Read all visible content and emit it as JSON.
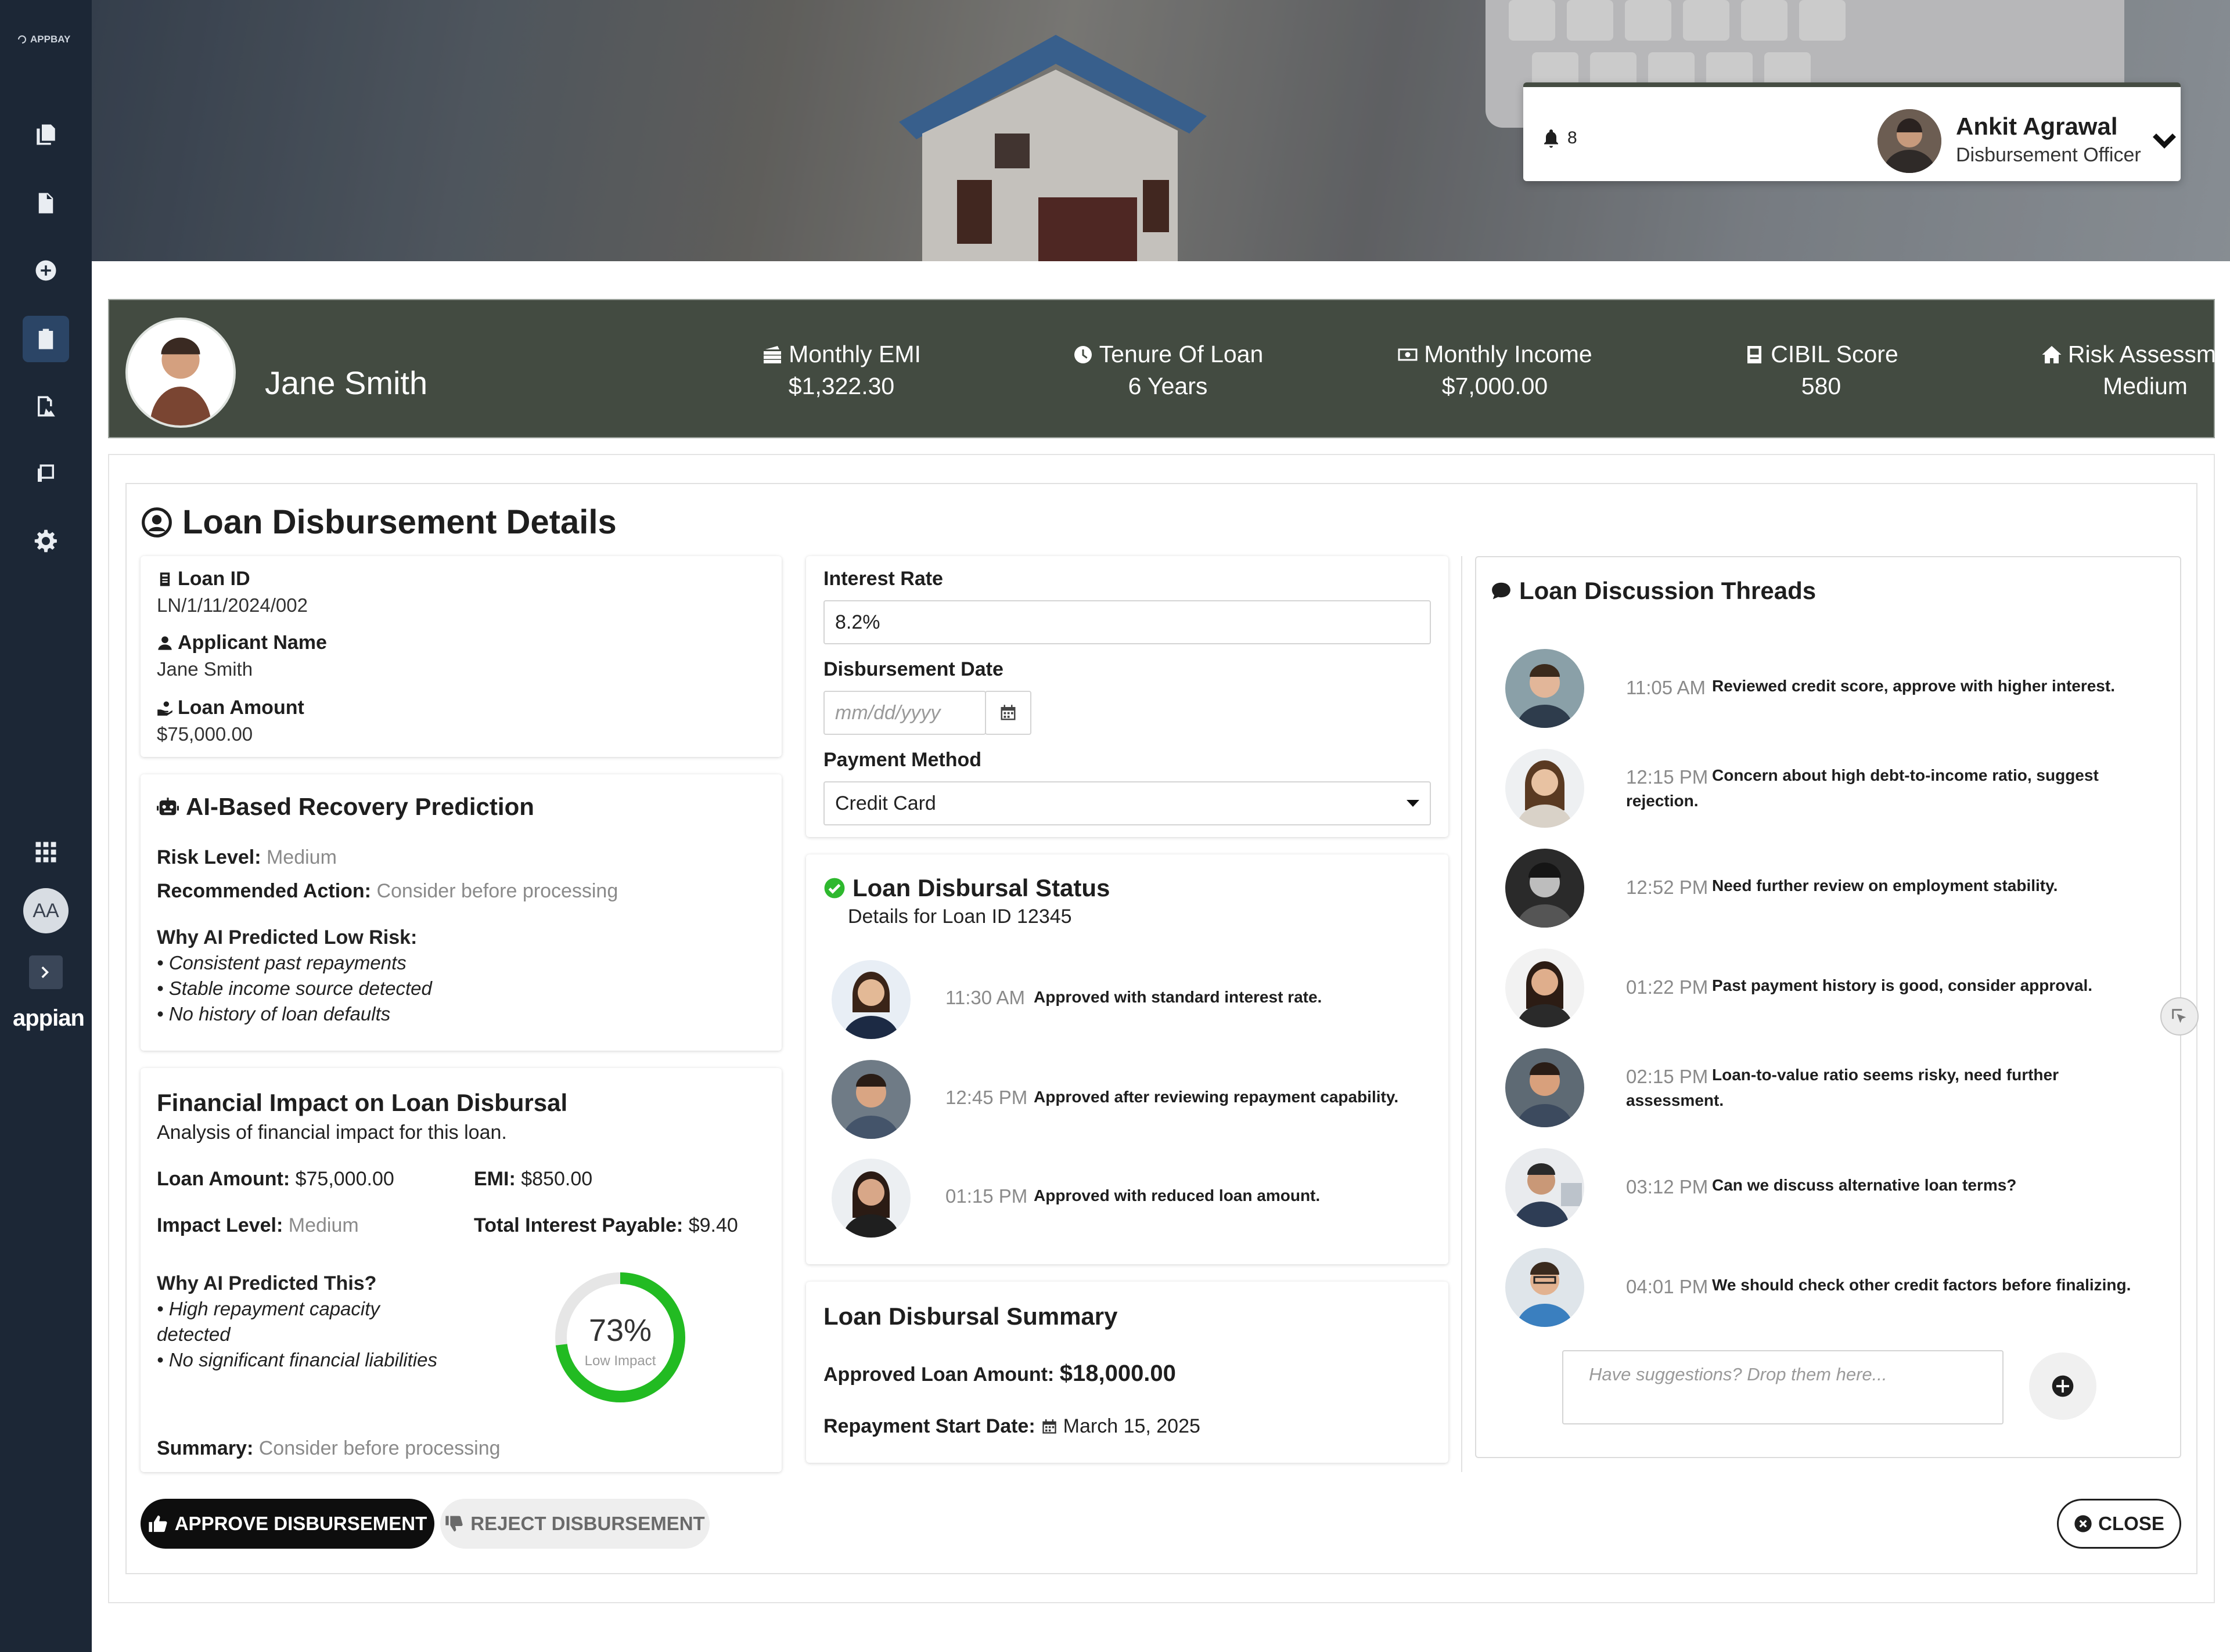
{
  "sidebar": {
    "logo_text": "APPBAY",
    "avatar_initials": "AA",
    "brand": "appian",
    "icons": [
      "copy-icon",
      "file-icon",
      "add-circle-icon",
      "clipboard-icon",
      "file-image-icon",
      "receipt-icon",
      "gear-icon",
      "apps-grid-icon",
      "chevron-right-icon"
    ]
  },
  "header": {
    "notifications_count": "8",
    "user_name": "Ankit Agrawal",
    "user_role": "Disbursement Officer"
  },
  "summary_bar": {
    "applicant": "Jane Smith",
    "items": [
      {
        "label": "Monthly EMI",
        "value": "$1,322.30",
        "icon": "money-stack-icon"
      },
      {
        "label": "Tenure Of Loan",
        "value": "6 Years",
        "icon": "clock-icon"
      },
      {
        "label": "Monthly Income",
        "value": "$7,000.00",
        "icon": "money-bill-icon"
      },
      {
        "label": "CIBIL Score",
        "value": "580",
        "icon": "score-card-icon"
      },
      {
        "label": "Risk Assessment",
        "value": "Medium",
        "icon": "home-icon"
      }
    ]
  },
  "page_title": "Loan Disbursement Details",
  "loan_info": {
    "loan_id_label": "Loan ID",
    "loan_id": "LN/1/11/2024/002",
    "applicant_label": "Applicant Name",
    "applicant": "Jane Smith",
    "amount_label": "Loan Amount",
    "amount": "$75,000.00"
  },
  "recovery": {
    "title": "AI-Based Recovery Prediction",
    "risk_label": "Risk Level:",
    "risk_value": "Medium",
    "action_label": "Recommended Action:",
    "action_value": "Consider before processing",
    "why_label": "Why AI Predicted Low Risk:",
    "reasons": [
      "• Consistent past repayments",
      "• Stable income source detected",
      "• No history of loan defaults"
    ]
  },
  "financial": {
    "title": "Financial Impact on Loan Disbursal",
    "subtitle": "Analysis of financial impact for this loan.",
    "amount_label": "Loan Amount:",
    "amount_value": "$75,000.00",
    "emi_label": "EMI:",
    "emi_value": "$850.00",
    "impact_label": "Impact Level:",
    "impact_value": "Medium",
    "interest_label": "Total Interest Payable:",
    "interest_value": "$9.40",
    "why_label": "Why AI Predicted This?",
    "reason_1a": "• High repayment capacity",
    "reason_1b": "detected",
    "reason_2": "• No significant financial liabilities",
    "gauge_percent": 73,
    "gauge_text": "73%",
    "gauge_caption": "Low Impact",
    "summary_label": "Summary:",
    "summary_value": "Consider before processing"
  },
  "form": {
    "interest_label": "Interest Rate",
    "interest_value": "8.2%",
    "date_label": "Disbursement Date",
    "date_placeholder": "mm/dd/yyyy",
    "payment_label": "Payment Method",
    "payment_value": "Credit Card"
  },
  "status": {
    "title": "Loan Disbursal Status",
    "subtitle": "Details for Loan ID 12345",
    "entries": [
      {
        "time": "11:30 AM",
        "text": "Approved with standard interest rate."
      },
      {
        "time": "12:45 PM",
        "text": "Approved after reviewing repayment capability."
      },
      {
        "time": "01:15 PM",
        "text": "Approved with reduced loan amount."
      }
    ]
  },
  "disbursal_summary": {
    "title": "Loan Disbursal Summary",
    "approved_label": "Approved Loan Amount:",
    "approved_value": "$18,000.00",
    "start_label": "Repayment Start Date:",
    "start_value": "March 15, 2025"
  },
  "threads": {
    "title": "Loan Discussion Threads",
    "entries": [
      {
        "time": "11:05 AM",
        "line1": "Reviewed credit score, approve with higher interest.",
        "line2": ""
      },
      {
        "time": "12:15 PM",
        "line1": "Concern about high debt-to-income ratio, suggest",
        "line2": "rejection."
      },
      {
        "time": "12:52 PM",
        "line1": "Need further review on employment stability.",
        "line2": ""
      },
      {
        "time": "01:22 PM",
        "line1": "Past payment history is good, consider approval.",
        "line2": ""
      },
      {
        "time": "02:15 PM",
        "line1": "Loan-to-value ratio seems risky, need further",
        "line2": "assessment."
      },
      {
        "time": "03:12 PM",
        "line1": "Can we discuss alternative loan terms?",
        "line2": ""
      },
      {
        "time": "04:01 PM",
        "line1": "We should check other credit factors before finalizing.",
        "line2": ""
      }
    ],
    "input_placeholder": "Have suggestions? Drop them here..."
  },
  "actions": {
    "approve": "APPROVE DISBURSEMENT",
    "reject": "REJECT DISBURSEMENT",
    "close": "CLOSE"
  },
  "colors": {
    "sidebar": "#1c2736",
    "summary_bar": "#434b41",
    "success": "#2eb82e",
    "gauge": "#22bb22"
  }
}
